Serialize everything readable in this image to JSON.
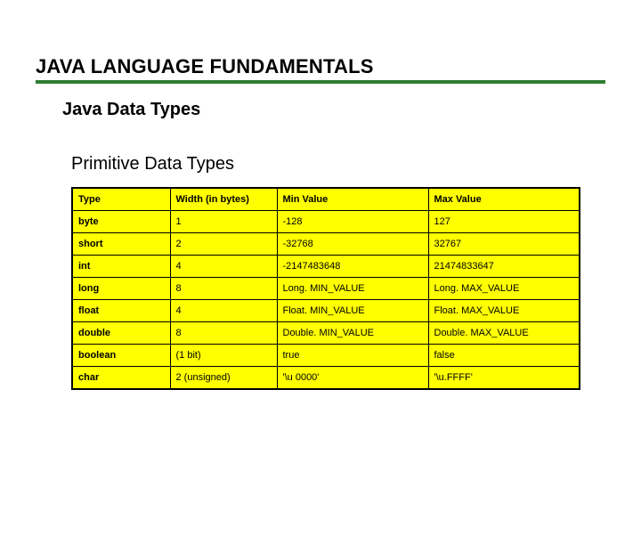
{
  "title": "JAVA LANGUAGE FUNDAMENTALS",
  "subtitle": "Java Data Types",
  "section": "Primitive Data Types",
  "table": {
    "headers": [
      "Type",
      "Width (in bytes)",
      "Min Value",
      "Max Value"
    ],
    "rows": [
      {
        "type": "byte",
        "width": "1",
        "min": "-128",
        "max": "127"
      },
      {
        "type": "short",
        "width": "2",
        "min": "-32768",
        "max": "32767"
      },
      {
        "type": "int",
        "width": "4",
        "min": "-2147483648",
        "max": "21474833647"
      },
      {
        "type": "long",
        "width": "8",
        "min": "Long. MIN_VALUE",
        "max": "Long. MAX_VALUE"
      },
      {
        "type": "float",
        "width": "4",
        "min": "Float. MIN_VALUE",
        "max": "Float. MAX_VALUE"
      },
      {
        "type": "double",
        "width": "8",
        "min": "Double. MIN_VALUE",
        "max": "Double. MAX_VALUE"
      },
      {
        "type": "boolean",
        "width": "(1 bit)",
        "min": "true",
        "max": "false"
      },
      {
        "type": "char",
        "width": "2 (unsigned)",
        "min": "'\\u 0000'",
        "max": "'\\u.FFFF'"
      }
    ]
  }
}
